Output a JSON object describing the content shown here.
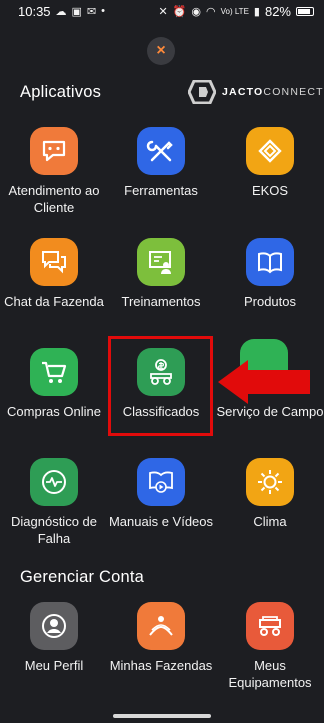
{
  "status_bar": {
    "time": "10:35",
    "battery": "82%",
    "network": "Vo) LTE"
  },
  "close_label": "×",
  "sections": {
    "apps_title": "Aplicativos",
    "account_title": "Gerenciar Conta"
  },
  "brand": {
    "bold": "JACTO",
    "light": "CONNECT"
  },
  "apps": [
    {
      "label": "Atendimento ao Cliente",
      "icon": "chat-bubble-icon",
      "color": "#f07a3a"
    },
    {
      "label": "Ferramentas",
      "icon": "tools-icon",
      "color": "#2f67e6"
    },
    {
      "label": "EKOS",
      "icon": "ekos-logo-icon",
      "color": "#f2a514"
    },
    {
      "label": "Chat da Fazenda",
      "icon": "chat-bubbles-icon",
      "color": "#f28c1e"
    },
    {
      "label": "Treinamentos",
      "icon": "training-board-icon",
      "color": "#7dbf3c"
    },
    {
      "label": "Produtos",
      "icon": "book-icon",
      "color": "#2f67e6"
    },
    {
      "label": "Compras Online",
      "icon": "cart-icon",
      "color": "#2fb255"
    },
    {
      "label": "Classificados",
      "icon": "tractor-dollar-icon",
      "color": "#2e9d55"
    },
    {
      "label": "Serviço de Campo",
      "icon": "field-service-icon",
      "color": "#2fb255"
    },
    {
      "label": "Diagnóstico de Falha",
      "icon": "diagnostic-pulse-icon",
      "color": "#2e9d55"
    },
    {
      "label": "Manuais e Vídeos",
      "icon": "manual-video-icon",
      "color": "#2f67e6"
    },
    {
      "label": "Clima",
      "icon": "sun-icon",
      "color": "#f2a514"
    }
  ],
  "account_apps": [
    {
      "label": "Meu Perfil",
      "icon": "profile-icon",
      "color": "#5d5d60"
    },
    {
      "label": "Minhas Fazendas",
      "icon": "farm-icon",
      "color": "#f07a3a"
    },
    {
      "label": "Meus Equipamentos",
      "icon": "equipment-icon",
      "color": "#e85a3a"
    }
  ]
}
